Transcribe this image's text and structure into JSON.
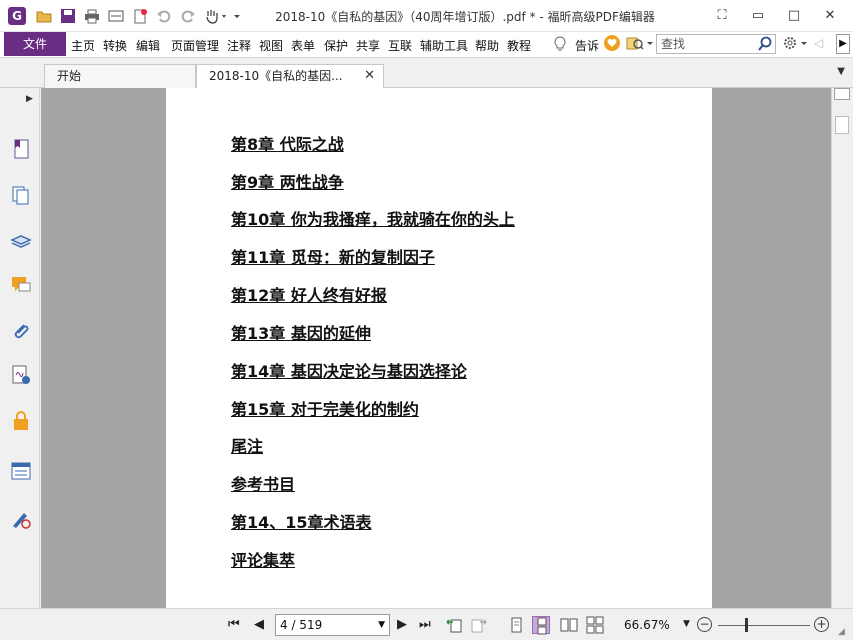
{
  "titlebar": {
    "title": "2018-10《自私的基因》（40周年增订版）.pdf * - 福昕高级PDF编辑器",
    "app_logo": "G",
    "quick_access_icons": [
      "open-folder-icon",
      "save-icon",
      "print-icon",
      "scan-icon",
      "new-icon",
      "undo-icon",
      "redo-icon",
      "hand-tool-icon"
    ],
    "window_controls": [
      "restore-layout-icon",
      "minimize-icon",
      "maximize-icon",
      "close-icon"
    ]
  },
  "menubar": {
    "file": "文件",
    "items": [
      "主页",
      "转换",
      "编辑",
      "页面管理",
      "注释",
      "视图",
      "表单",
      "保护",
      "共享",
      "互联",
      "辅助工具",
      "帮助",
      "教程"
    ],
    "tell_me": "告诉",
    "search_placeholder": "查找"
  },
  "tabs": [
    {
      "label": "开始",
      "active": false
    },
    {
      "label": "2018-10《自私的基因...",
      "active": true
    }
  ],
  "left_panel": {
    "icons": [
      "bookmark-icon",
      "pages-icon",
      "layers-icon",
      "comments-icon",
      "attachments-icon",
      "signature-icon",
      "security-icon",
      "form-fields-icon",
      "certify-icon"
    ]
  },
  "document": {
    "toc": [
      "第8章 代际之战",
      "第9章 两性战争",
      "第10章 你为我搔痒，我就骑在你的头上",
      "第11章 觅母：新的复制因子",
      "第12章 好人终有好报",
      "第13章 基因的延伸",
      "第14章 基因决定论与基因选择论",
      "第15章 对于完美化的制约",
      "尾注",
      "参考书目",
      "第14、15章术语表",
      "评论集萃"
    ]
  },
  "statusbar": {
    "page_indicator": "4 / 519",
    "zoom": "66.67%",
    "zoom_level_fraction": 0.3
  },
  "colors": {
    "brand": "#6a2d84",
    "doc_background": "#a5a5a5"
  }
}
